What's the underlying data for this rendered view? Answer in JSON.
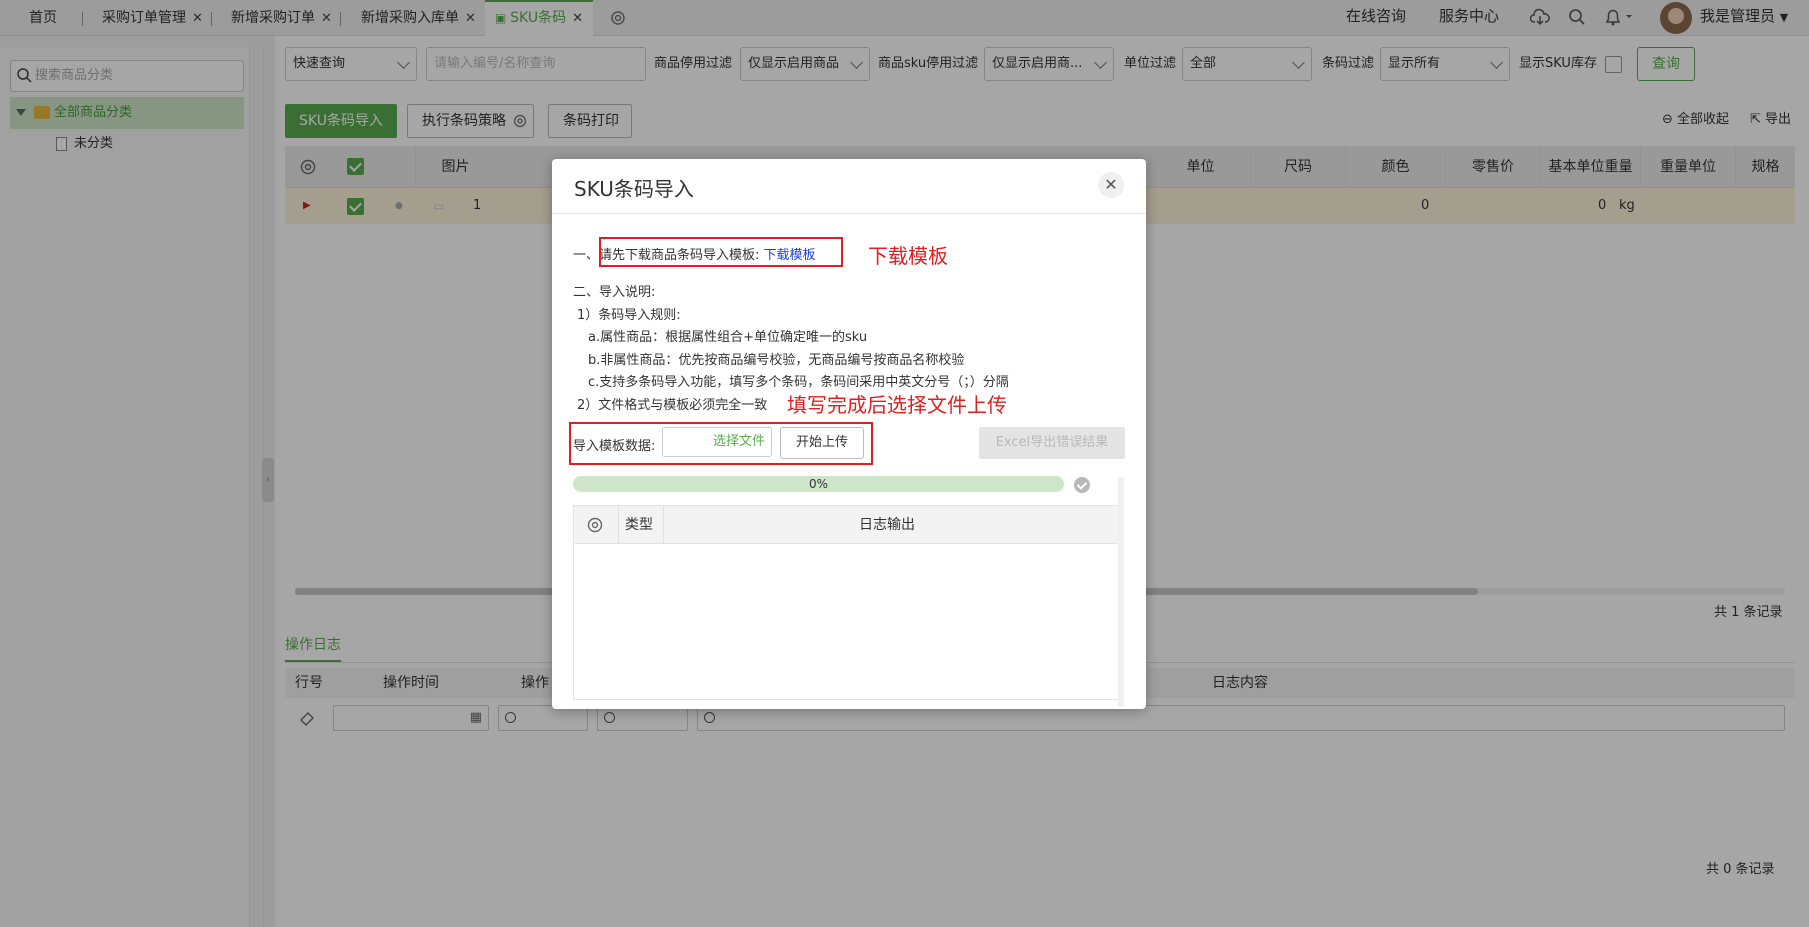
{
  "tabs": [
    {
      "label": "首页",
      "closable": false,
      "active": false
    },
    {
      "label": "采购订单管理",
      "closable": true,
      "active": false
    },
    {
      "label": "新增采购订单",
      "closable": true,
      "active": false
    },
    {
      "label": "新增采购入库单",
      "closable": true,
      "active": false
    },
    {
      "label": "SKU条码",
      "closable": true,
      "active": true
    }
  ],
  "topbar": {
    "online_consult": "在线咨询",
    "service_center": "服务中心",
    "user_name": "我是管理员"
  },
  "sidebar": {
    "search_placeholder": "搜索商品分类",
    "root_label": "全部商品分类",
    "child_label": "未分类"
  },
  "filters": {
    "quick_query": "快速查询",
    "search_placeholder": "请输入编号/名称查询",
    "product_disable_label": "商品停用过滤",
    "product_disable_value": "仅显示启用商品",
    "sku_disable_label": "商品sku停用过滤",
    "sku_disable_value": "仅显示启用商...",
    "unit_label": "单位过滤",
    "unit_value": "全部",
    "barcode_label": "条码过滤",
    "barcode_value": "显示所有",
    "show_sku_stock_label": "显示SKU库存",
    "query_button": "查询"
  },
  "toolbar": {
    "import_button": "SKU条码导入",
    "strategy_button": "执行条码策略",
    "print_button": "条码打印",
    "collapse_all": "全部收起",
    "export": "导出"
  },
  "table": {
    "headers": {
      "image": "图片",
      "unit": "单位",
      "size": "尺码",
      "color": "颜色",
      "retail_price": "零售价",
      "base_weight": "基本单位重量",
      "weight_unit": "重量单位",
      "spec": "规格"
    },
    "row": {
      "index": "1",
      "retail_price": "0",
      "base_weight": "0",
      "weight_unit": "kg"
    },
    "total": "共 1 条记录"
  },
  "oplog": {
    "tab": "操作日志",
    "headers": {
      "row_no": "行号",
      "op_time": "操作时间",
      "operator": "操作",
      "content": "日志内容"
    },
    "total": "共 0 条记录"
  },
  "modal": {
    "title": "SKU条码导入",
    "step1_prefix": "一、",
    "step1_text": "请先下载商品条码导入模板:",
    "download_link": "下载模板",
    "annotation_download": "下载模板",
    "step2_title": "二、导入说明:",
    "rule1_title": "1）条码导入规则:",
    "rule_a": "a.属性商品：根据属性组合+单位确定唯一的sku",
    "rule_b": "b.非属性商品：优先按商品编号校验，无商品编号按商品名称校验",
    "rule_c": "c.支持多条码导入功能，填写多个条码，条码间采用中英文分号（；）分隔",
    "rule2": "2）文件格式与模板必须完全一致",
    "annotation_upload": "填写完成后选择文件上传",
    "upload_label": "导入模板数据:",
    "choose_file": "选择文件",
    "start_upload": "开始上传",
    "excel_export": "Excel导出错误结果",
    "progress_text": "0%",
    "progress_value": 0,
    "log_col_type": "类型",
    "log_col_output": "日志输出"
  },
  "colors": {
    "accent": "#5aab4f",
    "annotation_red": "#e02020",
    "link_blue": "#1a3fe0"
  }
}
